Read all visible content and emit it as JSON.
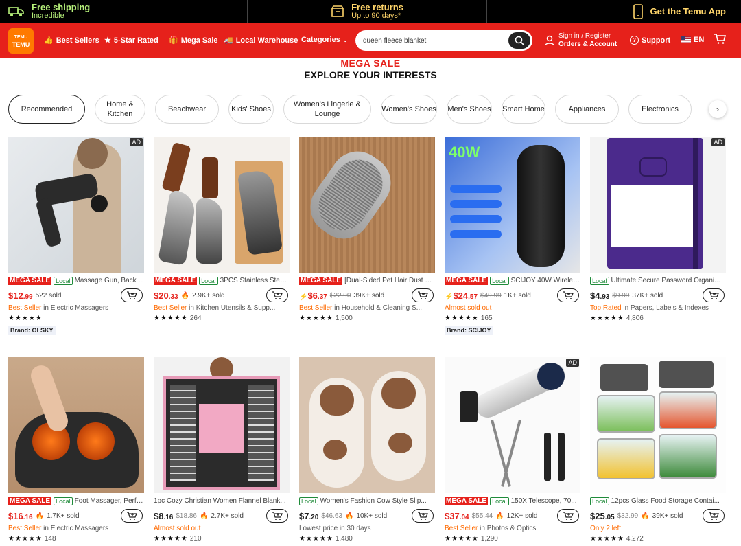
{
  "topbar": {
    "shipping_title": "Free shipping",
    "shipping_sub": "Incredible",
    "returns_title": "Free returns",
    "returns_sub": "Up to 90 days*",
    "app_label": "Get the Temu App"
  },
  "nav": {
    "logo_top": "TEMU",
    "logo_bottom": "TEMU",
    "best_sellers": "Best Sellers",
    "five_star": "5-Star Rated",
    "mega_sale": "Mega Sale",
    "local_warehouse": "Local Warehouse",
    "categories": "Categories",
    "search_value": "queen fleece blanket",
    "signin": "Sign in / Register",
    "orders": "Orders & Account",
    "support": "Support",
    "lang": "EN"
  },
  "banner": {
    "mega": "MEGA SALE",
    "explore": "EXPLORE YOUR INTERESTS"
  },
  "chips": [
    "Recommended",
    "Home & Kitchen",
    "Beachwear",
    "Kids' Shoes",
    "Women's Lingerie & Lounge",
    "Women's Shoes",
    "Men's Shoes",
    "Smart Home",
    "Appliances",
    "Electronics"
  ],
  "badges": {
    "mega": "MEGA SALE",
    "local": "Local",
    "ad": "AD"
  },
  "products": [
    {
      "title": "Massage Gun, Back ...",
      "price_whole": "$12",
      "price_cents": ".99",
      "orig": "",
      "sold": "522 sold",
      "cat_hl": "Best Seller",
      "cat_rest": " in Electric Massagers",
      "stars": "★★★★★",
      "count": "",
      "brand": "Brand: OLSKY"
    },
    {
      "title": "3PCS Stainless Steel...",
      "price_whole": "$20",
      "price_cents": ".33",
      "orig": "",
      "sold": "2.9K+ sold",
      "cat_hl": "Best Seller",
      "cat_rest": " in Kitchen Utensils & Supp...",
      "stars": "★★★★★",
      "count": "264",
      "brand": ""
    },
    {
      "title": "[Dual-Sided Pet Hair Dust B...",
      "price_whole": "$6",
      "price_cents": ".37",
      "orig": "$22.90",
      "sold": "39K+ sold",
      "cat_hl": "Best Seller",
      "cat_rest": " in Household & Cleaning S...",
      "stars": "★★★★★",
      "count": "1,500",
      "brand": ""
    },
    {
      "title": "SCIJOY 40W Wireles...",
      "price_whole": "$24",
      "price_cents": ".57",
      "orig": "$49.99",
      "sold": "1K+ sold",
      "cat_hl": "Almost sold out",
      "cat_rest": "",
      "stars": "★★★★★",
      "count": "165",
      "brand": "Brand: SCIJOY"
    },
    {
      "title": "Ultimate Secure Password Organi...",
      "price_whole": "$4",
      "price_cents": ".93",
      "orig": "$9.99",
      "sold": "37K+ sold",
      "cat_hl": "Top Rated",
      "cat_rest": " in Papers, Labels & Indexes",
      "stars": "★★★★★",
      "count": "4,806",
      "brand": ""
    },
    {
      "title": "Foot Massager, Perfe...",
      "price_whole": "$16",
      "price_cents": ".16",
      "orig": "",
      "sold": "1.7K+ sold",
      "cat_hl": "Best Seller",
      "cat_rest": " in Electric Massagers",
      "stars": "★★★★★",
      "count": "148",
      "brand": ""
    },
    {
      "title": "1pc Cozy Christian Women Flannel Blank...",
      "price_whole": "$8",
      "price_cents": ".16",
      "orig": "$18.86",
      "sold": "2.7K+ sold",
      "cat_hl": "Almost sold out",
      "cat_rest": "",
      "stars": "★★★★★",
      "count": "210",
      "brand": ""
    },
    {
      "title": "Women's Fashion Cow Style Slip...",
      "price_whole": "$7",
      "price_cents": ".20",
      "orig": "$46.63",
      "sold": "10K+ sold",
      "cat_hl": "",
      "cat_rest": "Lowest price in 30 days",
      "stars": "★★★★★",
      "count": "1,480",
      "brand": ""
    },
    {
      "title": "150X Telescope, 70...",
      "price_whole": "$37",
      "price_cents": ".04",
      "orig": "$55.44",
      "sold": "12K+ sold",
      "cat_hl": "Best Seller",
      "cat_rest": " in Photos & Optics",
      "stars": "★★★★★",
      "count": "1,290",
      "brand": ""
    },
    {
      "title": "12pcs Glass Food Storage Contai...",
      "price_whole": "$25",
      "price_cents": ".05",
      "orig": "$32.99",
      "sold": "39K+ sold",
      "cat_hl": "Only 2 left",
      "cat_rest": "",
      "stars": "★★★★★",
      "count": "4,272",
      "brand": ""
    }
  ]
}
